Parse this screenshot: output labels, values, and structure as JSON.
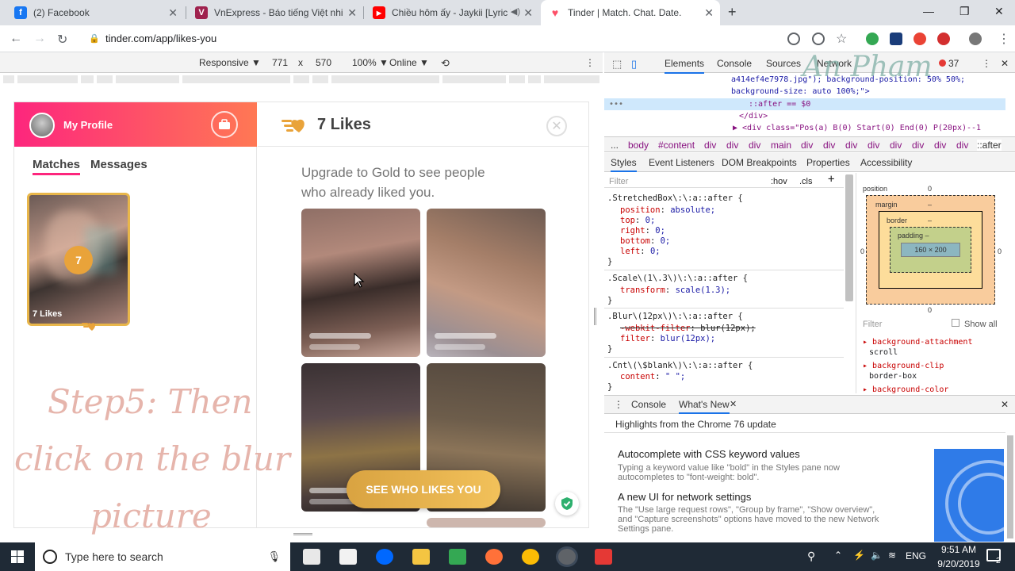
{
  "browser": {
    "tabs": [
      {
        "title": "(2) Facebook",
        "color": "#1877f2",
        "glyph": "f"
      },
      {
        "title": "VnExpress - Báo tiếng Việt nhiều",
        "color": "#9f224e",
        "glyph": "V"
      },
      {
        "title": "Chiều hôm ấy - Jaykii [Lyric V",
        "color": "#ff0000",
        "glyph": "▶"
      },
      {
        "title": "Tinder | Match. Chat. Date.",
        "color": "#fd5068",
        "glyph": "♥"
      }
    ],
    "url": "tinder.com/app/likes-you"
  },
  "device_toolbar": {
    "mode": "Responsive ▼",
    "width": "771",
    "times": "x",
    "height": "570",
    "zoom": "100% ▼",
    "network": "Online ▼"
  },
  "tinder": {
    "profile_label": "My Profile",
    "tabs": {
      "matches": "Matches",
      "messages": "Messages"
    },
    "likes_count": "7",
    "likes_card_label": "7 Likes",
    "header_title": "7 Likes",
    "close_glyph": "✕",
    "upgrade_text": "Upgrade to Gold to see people who already liked you.",
    "cta": "SEE WHO LIKES YOU",
    "accent": "#fd267d",
    "gold": "#e9a33a"
  },
  "overlay": {
    "line1": "Step5: Then",
    "line2": "click on the blur",
    "line3": "picture",
    "watermark": "An Pham"
  },
  "devtools": {
    "tabs": [
      "Elements",
      "Console",
      "Sources",
      "Network"
    ],
    "error_count": "37",
    "dom_lines": [
      "a414ef4e7978.jpg\"); background-position: 50% 50%;",
      "background-size: auto 100%;\">",
      "::after == $0",
      "</div>",
      "▶ <div class=\"Pos(a) B(0) Start(0) End(0) P(20px)--1"
    ],
    "breadcrumbs": [
      "...",
      "body",
      "#content",
      "div",
      "div",
      "div",
      "main",
      "div",
      "div",
      "div",
      "div",
      "div",
      "div",
      "div",
      "div",
      "::after"
    ],
    "style_tabs": [
      "Styles",
      "Event Listeners",
      "DOM Breakpoints",
      "Properties",
      "Accessibility"
    ],
    "filter_placeholder": "Filter",
    "hov": ":hov",
    "cls": ".cls",
    "plus": "+",
    "rules": [
      {
        "sel": ".StretchedBox\\:\\:a::after {",
        "props": [
          [
            "position",
            "absolute;"
          ],
          [
            "top",
            "0;"
          ],
          [
            "right",
            "0;"
          ],
          [
            "bottom",
            "0;"
          ],
          [
            "left",
            "0;"
          ]
        ]
      },
      {
        "sel": ".Scale\\(1\\.3\\)\\:\\:a::after {",
        "props": [
          [
            "transform",
            "scale(1.3);"
          ]
        ]
      },
      {
        "sel": ".Blur\\(12px\\)\\:\\:a::after {",
        "props": [
          [
            "-webkit-filter",
            "blur(12px);"
          ],
          [
            "filter",
            "blur(12px);"
          ]
        ]
      },
      {
        "sel": ".Cnt\\(\\$blank\\)\\:\\:a::after {",
        "props": [
          [
            "content",
            "\" \";"
          ]
        ]
      }
    ],
    "close_brace": "}",
    "box": {
      "position_label": "position",
      "position_val": "0",
      "margin_label": "margin",
      "border_label": "border",
      "padding_label": "padding –",
      "dash": "–",
      "content": "160 × 200",
      "zero": "0"
    },
    "computed_filter": "Filter",
    "show_all": "Show all",
    "computed": [
      [
        "background-attachment",
        "scroll"
      ],
      [
        "background-clip",
        "border-box"
      ],
      [
        "background-color",
        ""
      ]
    ],
    "drawer_tabs": [
      "Console",
      "What's New"
    ],
    "drawer_close": "✕",
    "whats_new_title": "Highlights from the Chrome 76 update",
    "items": [
      {
        "h": "Autocomplete with CSS keyword values",
        "p": "Typing a keyword value like \"bold\" in the Styles pane now autocompletes to \"font-weight: bold\"."
      },
      {
        "h": "A new UI for network settings",
        "p": "The \"Use large request rows\", \"Group by frame\", \"Show overview\", and \"Capture screenshots\" options have moved to the new Network Settings pane."
      }
    ]
  },
  "taskbar": {
    "search_placeholder": "Type here to search",
    "lang": "ENG",
    "time": "9:51 AM",
    "date": "9/20/2019",
    "notif": "2"
  }
}
